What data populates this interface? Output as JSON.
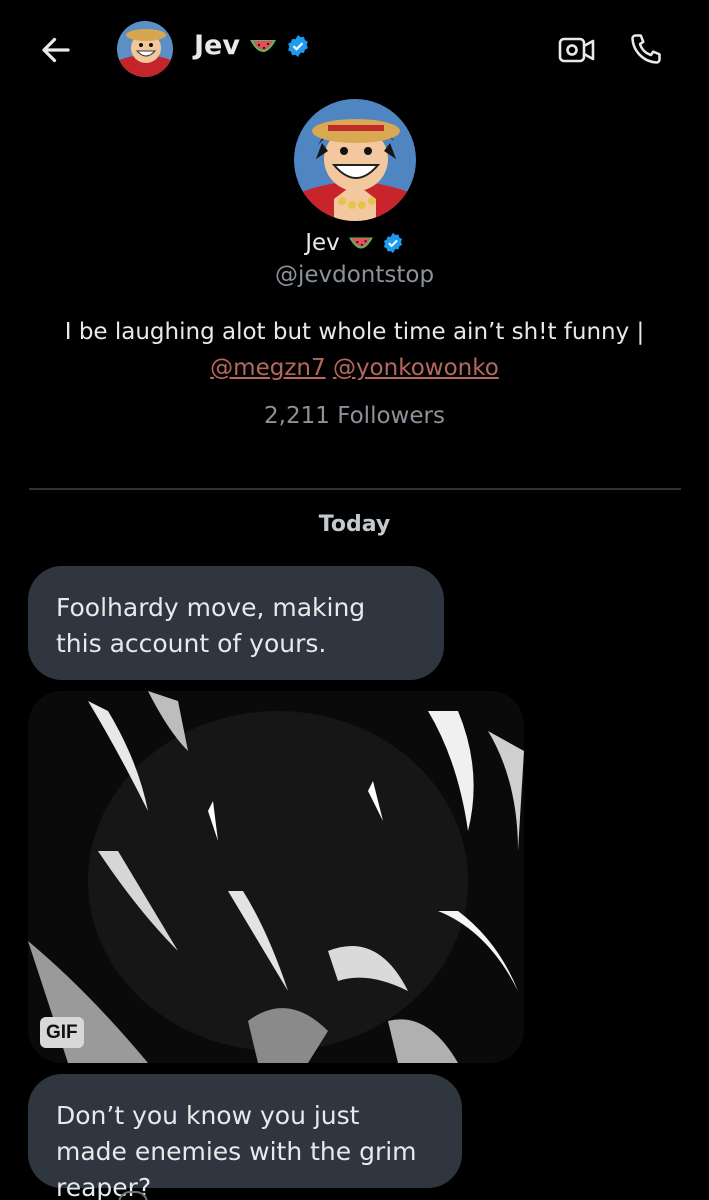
{
  "header": {
    "name": "Jev",
    "back_icon": "arrow-left-icon",
    "video_icon": "video-call-icon",
    "call_icon": "phone-icon"
  },
  "profile": {
    "name": "Jev",
    "handle": "@jevdontstop",
    "bio": "I be laughing alot but whole time ain’t sh!t funny |",
    "mentions": [
      "@megzn7",
      "@yonkowonko"
    ],
    "followers": "2,211 Followers"
  },
  "conversation": {
    "date_label": "Today",
    "messages": [
      {
        "type": "text",
        "text": "Foolhardy move, making this account of yours."
      },
      {
        "type": "gif",
        "badge": "GIF"
      },
      {
        "type": "text",
        "text": "Don’t you know you just made enemies with the grim reaper?"
      }
    ]
  },
  "colors": {
    "background": "#000000",
    "bubble": "#2f3640",
    "verified_badge": "#1d9bf0",
    "mention": "#b5685e",
    "secondary_text": "#8b9299"
  }
}
